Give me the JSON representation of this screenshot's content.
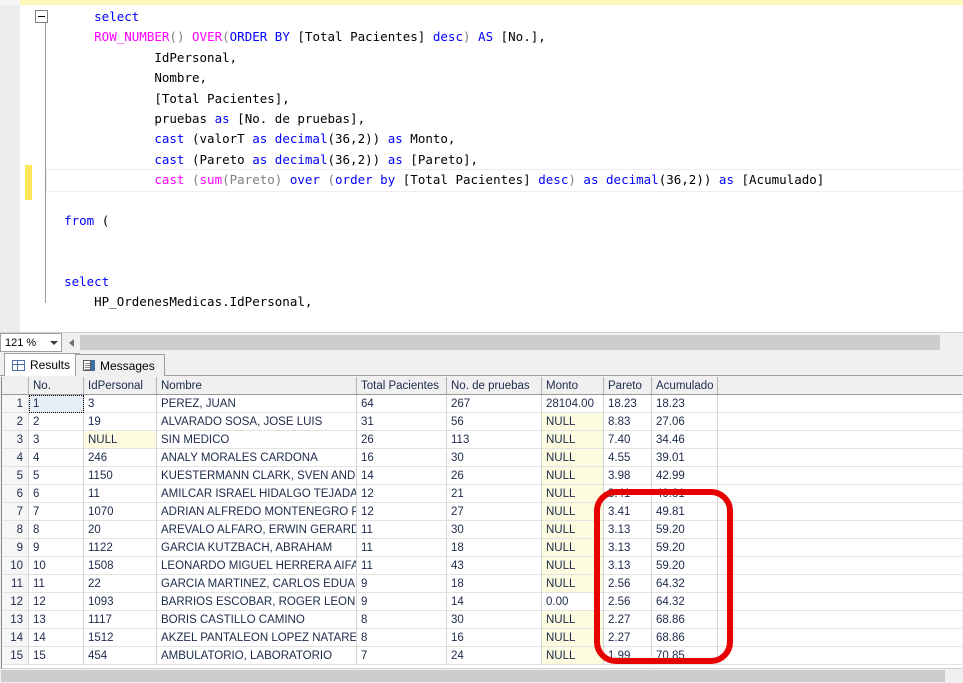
{
  "editor": {
    "zoom_level": "121 %",
    "collapse_icon": "collapse-minus-icon",
    "lines": [
      {
        "id": "l1",
        "current": false,
        "tokens": [
          {
            "t": "      ",
            "c": "plain"
          },
          {
            "t": "select",
            "c": "kw"
          }
        ]
      },
      {
        "id": "l2",
        "current": false,
        "tokens": [
          {
            "t": "      ",
            "c": "plain"
          },
          {
            "t": "ROW_NUMBER",
            "c": "fn"
          },
          {
            "t": "()",
            "c": "br"
          },
          {
            "t": " ",
            "c": "plain"
          },
          {
            "t": "OVER",
            "c": "fn"
          },
          {
            "t": "(",
            "c": "br"
          },
          {
            "t": "ORDER BY",
            "c": "kw"
          },
          {
            "t": " [Total Pacientes] ",
            "c": "plain"
          },
          {
            "t": "desc",
            "c": "kw"
          },
          {
            "t": ")",
            "c": "br"
          },
          {
            "t": " ",
            "c": "plain"
          },
          {
            "t": "AS",
            "c": "kw"
          },
          {
            "t": " [No.],",
            "c": "plain"
          }
        ]
      },
      {
        "id": "l3",
        "current": false,
        "tokens": [
          {
            "t": "              IdPersonal,",
            "c": "plain"
          }
        ]
      },
      {
        "id": "l4",
        "current": false,
        "tokens": [
          {
            "t": "              Nombre,",
            "c": "plain"
          }
        ]
      },
      {
        "id": "l5",
        "current": false,
        "tokens": [
          {
            "t": "              [Total Pacientes],",
            "c": "plain"
          }
        ]
      },
      {
        "id": "l6",
        "current": false,
        "tokens": [
          {
            "t": "              pruebas ",
            "c": "plain"
          },
          {
            "t": "as",
            "c": "kw"
          },
          {
            "t": " [No. de pruebas],",
            "c": "plain"
          }
        ]
      },
      {
        "id": "l7",
        "current": false,
        "tokens": [
          {
            "t": "              ",
            "c": "plain"
          },
          {
            "t": "cast",
            "c": "kw"
          },
          {
            "t": " (valorT ",
            "c": "plain"
          },
          {
            "t": "as",
            "c": "kw"
          },
          {
            "t": " ",
            "c": "plain"
          },
          {
            "t": "decimal",
            "c": "kw"
          },
          {
            "t": "(36,2))",
            "c": "plain"
          },
          {
            "t": " ",
            "c": "plain"
          },
          {
            "t": "as",
            "c": "kw"
          },
          {
            "t": " Monto,",
            "c": "plain"
          }
        ]
      },
      {
        "id": "l8",
        "current": false,
        "tokens": [
          {
            "t": "              ",
            "c": "plain"
          },
          {
            "t": "cast",
            "c": "kw"
          },
          {
            "t": " (Pareto ",
            "c": "plain"
          },
          {
            "t": "as",
            "c": "kw"
          },
          {
            "t": " ",
            "c": "plain"
          },
          {
            "t": "decimal",
            "c": "kw"
          },
          {
            "t": "(36,2))",
            "c": "plain"
          },
          {
            "t": " ",
            "c": "plain"
          },
          {
            "t": "as",
            "c": "kw"
          },
          {
            "t": " [Pareto],",
            "c": "plain"
          }
        ]
      },
      {
        "id": "l9",
        "current": true,
        "tokens": [
          {
            "t": "              ",
            "c": "plain"
          },
          {
            "t": "cast",
            "c": "fn"
          },
          {
            "t": " (",
            "c": "br"
          },
          {
            "t": "sum",
            "c": "fn"
          },
          {
            "t": "(Pareto)",
            "c": "br"
          },
          {
            "t": " ",
            "c": "plain"
          },
          {
            "t": "over",
            "c": "kw"
          },
          {
            "t": " (",
            "c": "br"
          },
          {
            "t": "order by",
            "c": "kw"
          },
          {
            "t": " [Total Pacientes] ",
            "c": "plain"
          },
          {
            "t": "desc",
            "c": "kw"
          },
          {
            "t": ")",
            "c": "br"
          },
          {
            "t": " ",
            "c": "plain"
          },
          {
            "t": "as",
            "c": "kw"
          },
          {
            "t": " ",
            "c": "plain"
          },
          {
            "t": "decimal",
            "c": "kw"
          },
          {
            "t": "(36,2))",
            "c": "plain"
          },
          {
            "t": " ",
            "c": "plain"
          },
          {
            "t": "as",
            "c": "kw"
          },
          {
            "t": " [Acumulado]",
            "c": "plain"
          }
        ]
      },
      {
        "id": "l10",
        "current": false,
        "tokens": [
          {
            "t": "",
            "c": "plain"
          }
        ]
      },
      {
        "id": "l11",
        "current": false,
        "tokens": [
          {
            "t": "  ",
            "c": "plain"
          },
          {
            "t": "from",
            "c": "kw"
          },
          {
            "t": " (",
            "c": "plain"
          }
        ]
      },
      {
        "id": "l12",
        "current": false,
        "tokens": [
          {
            "t": "",
            "c": "plain"
          }
        ]
      },
      {
        "id": "l13",
        "current": false,
        "tokens": [
          {
            "t": "",
            "c": "plain"
          }
        ]
      },
      {
        "id": "l14",
        "current": false,
        "tokens": [
          {
            "t": "  ",
            "c": "plain"
          },
          {
            "t": "select",
            "c": "kw"
          }
        ]
      },
      {
        "id": "l15",
        "current": false,
        "tokens": [
          {
            "t": "      HP_OrdenesMedicas.IdPersonal,",
            "c": "plain"
          }
        ]
      }
    ]
  },
  "results": {
    "tabs": [
      {
        "label": "Results",
        "icon": "results-grid-icon",
        "active": true
      },
      {
        "label": "Messages",
        "icon": "messages-page-icon",
        "active": false
      }
    ],
    "columns": [
      "No.",
      "IdPersonal",
      "Nombre",
      "Total Pacientes",
      "No. de pruebas",
      "Monto",
      "Pareto",
      "Acumulado"
    ],
    "rows": [
      {
        "n": "1",
        "no": "1",
        "idpersonal": "3",
        "nombre": "PEREZ, JUAN",
        "total": "64",
        "pruebas": "267",
        "monto": "28104.00",
        "pareto": "18.23",
        "acumulado": "18.23"
      },
      {
        "n": "2",
        "no": "2",
        "idpersonal": "19",
        "nombre": "ALVARADO SOSA, JOSE LUIS",
        "total": "31",
        "pruebas": "56",
        "monto": "NULL",
        "pareto": "8.83",
        "acumulado": "27.06"
      },
      {
        "n": "3",
        "no": "3",
        "idpersonal": "NULL",
        "nombre": "SIN MEDICO",
        "total": "26",
        "pruebas": "113",
        "monto": "NULL",
        "pareto": "7.40",
        "acumulado": "34.46"
      },
      {
        "n": "4",
        "no": "4",
        "idpersonal": "246",
        "nombre": "ANALY MORALES CARDONA",
        "total": "16",
        "pruebas": "30",
        "monto": "NULL",
        "pareto": "4.55",
        "acumulado": "39.01"
      },
      {
        "n": "5",
        "no": "5",
        "idpersonal": "1150",
        "nombre": "KUESTERMANN CLARK, SVEN ANDRE",
        "total": "14",
        "pruebas": "26",
        "monto": "NULL",
        "pareto": "3.98",
        "acumulado": "42.99"
      },
      {
        "n": "6",
        "no": "6",
        "idpersonal": "11",
        "nombre": "AMILCAR ISRAEL HIDALGO TEJADA",
        "total": "12",
        "pruebas": "21",
        "monto": "NULL",
        "pareto": "3.41",
        "acumulado": "49.81"
      },
      {
        "n": "7",
        "no": "7",
        "idpersonal": "1070",
        "nombre": "ADRIAN ALFREDO MONTENEGRO PAIZ",
        "total": "12",
        "pruebas": "27",
        "monto": "NULL",
        "pareto": "3.41",
        "acumulado": "49.81"
      },
      {
        "n": "8",
        "no": "8",
        "idpersonal": "20",
        "nombre": "AREVALO ALFARO, ERWIN GERARDO",
        "total": "11",
        "pruebas": "30",
        "monto": "NULL",
        "pareto": "3.13",
        "acumulado": "59.20"
      },
      {
        "n": "9",
        "no": "9",
        "idpersonal": "1122",
        "nombre": "GARCIA KUTZBACH, ABRAHAM",
        "total": "11",
        "pruebas": "18",
        "monto": "NULL",
        "pareto": "3.13",
        "acumulado": "59.20"
      },
      {
        "n": "10",
        "no": "10",
        "idpersonal": "1508",
        "nombre": "LEONARDO MIGUEL HERRERA AIFAN",
        "total": "11",
        "pruebas": "43",
        "monto": "NULL",
        "pareto": "3.13",
        "acumulado": "59.20"
      },
      {
        "n": "11",
        "no": "11",
        "idpersonal": "22",
        "nombre": "GARCIA MARTINEZ, CARLOS EDUARDO",
        "total": "9",
        "pruebas": "18",
        "monto": "NULL",
        "pareto": "2.56",
        "acumulado": "64.32"
      },
      {
        "n": "12",
        "no": "12",
        "idpersonal": "1093",
        "nombre": "BARRIOS ESCOBAR, ROGER LEONEL",
        "total": "9",
        "pruebas": "14",
        "monto": "0.00",
        "pareto": "2.56",
        "acumulado": "64.32"
      },
      {
        "n": "13",
        "no": "13",
        "idpersonal": "1117",
        "nombre": "BORIS  CASTILLO CAMINO",
        "total": "8",
        "pruebas": "30",
        "monto": "NULL",
        "pareto": "2.27",
        "acumulado": "68.86"
      },
      {
        "n": "14",
        "no": "14",
        "idpersonal": "1512",
        "nombre": "AKZEL PANTALEON LOPEZ NATARENO",
        "total": "8",
        "pruebas": "16",
        "monto": "NULL",
        "pareto": "2.27",
        "acumulado": "68.86"
      },
      {
        "n": "15",
        "no": "15",
        "idpersonal": "454",
        "nombre": "AMBULATORIO, LABORATORIO",
        "total": "7",
        "pruebas": "24",
        "monto": "NULL",
        "pareto": "1.99",
        "acumulado": "70.85"
      }
    ]
  },
  "annotation": {
    "shape": "rounded-rectangle",
    "color": "#e60000",
    "covers_columns": [
      "Pareto",
      "Acumulado"
    ],
    "covers_rows": [
      "6",
      "7",
      "8",
      "9",
      "10",
      "11",
      "12",
      "13",
      "14"
    ]
  }
}
